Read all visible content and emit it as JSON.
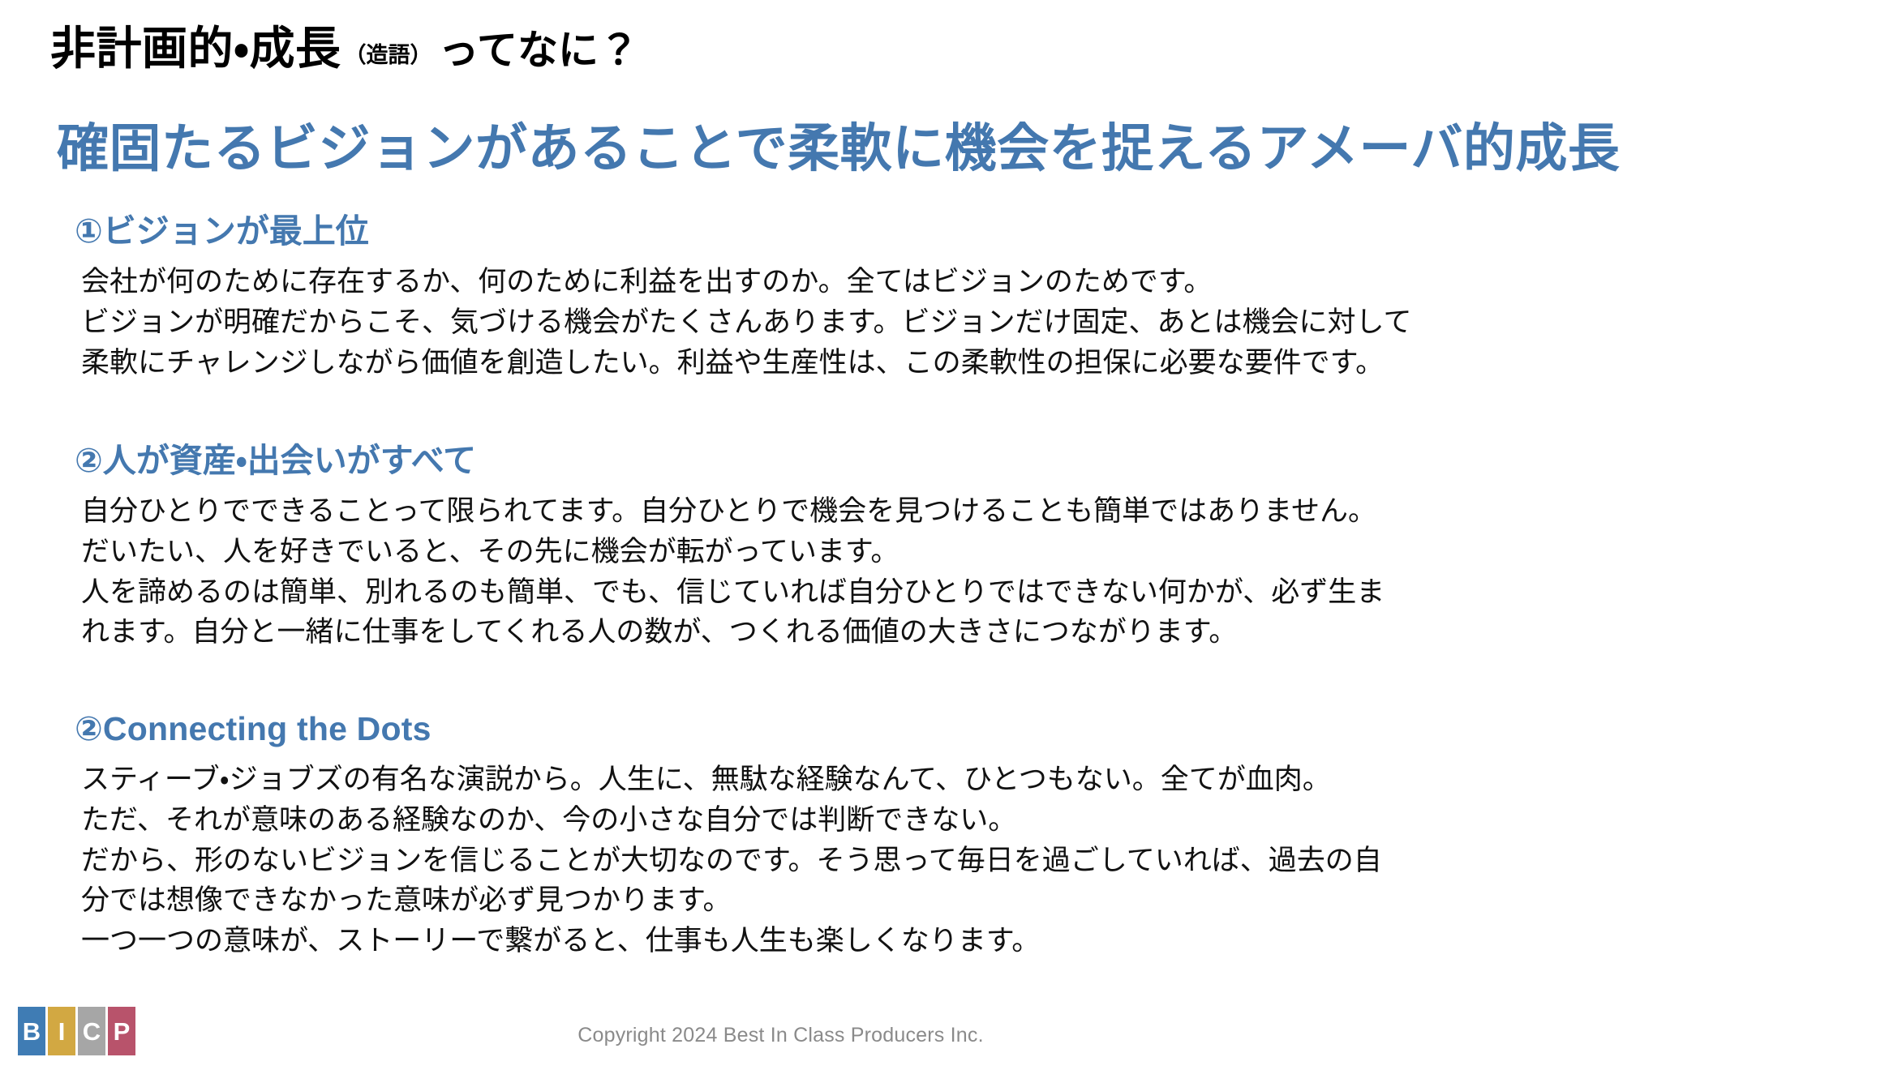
{
  "slide": {
    "title": {
      "main": "非計画的・成長",
      "paren": "（造語）",
      "tail": "ってなに？"
    },
    "headline": "確固たるビジョンがあることで柔軟に機会を捉えるアメーバ的成長",
    "accent_color": "#4478AF",
    "sections": [
      {
        "heading": "①ビジョンが最上位",
        "lines": [
          "会社が何のために存在するか、何のために利益を出すのか。全てはビジョンのためです。",
          "ビジョンが明確だからこそ、気づける機会がたくさんあります。ビジョンだけ固定、あとは機会に対して",
          "柔軟にチャレンジしながら価値を創造したい。利益や生産性は、この柔軟性の担保に必要な要件です。"
        ]
      },
      {
        "heading": "②人が資産・出会いがすべて",
        "lines": [
          "自分ひとりでできることって限られてます。自分ひとりで機会を見つけることも簡単ではありません。",
          "だいたい、人を好きでいると、その先に機会が転がっています。",
          "人を諦めるのは簡単、別れるのも簡単、でも、信じていれば自分ひとりではできない何かが、必ず生ま",
          "れます。自分と一緒に仕事をしてくれる人の数が、つくれる価値の大きさにつながります。"
        ]
      },
      {
        "heading": "②Connecting the Dots",
        "lines": [
          "スティーブ・ジョブズの有名な演説から。人生に、無駄な経験なんて、ひとつもない。全てが血肉。",
          "ただ、それが意味のある経験なのか、今の小さな自分では判断できない。",
          "だから、形のないビジョンを信じることが大切なのです。そう思って毎日を過ごしていれば、過去の自",
          "分では想像できなかった意味が必ず見つかります。",
          "一つ一つの意味が、ストーリーで繋がると、仕事も人生も楽しくなります。"
        ]
      }
    ],
    "footer": {
      "logo": [
        {
          "letter": "B",
          "color": "#3F7CB4"
        },
        {
          "letter": "I",
          "color": "#D2A842"
        },
        {
          "letter": "C",
          "color": "#A6A6A6"
        },
        {
          "letter": "P",
          "color": "#B8536B"
        }
      ],
      "copyright": "Copyright 2024 Best In Class Producers Inc."
    }
  }
}
